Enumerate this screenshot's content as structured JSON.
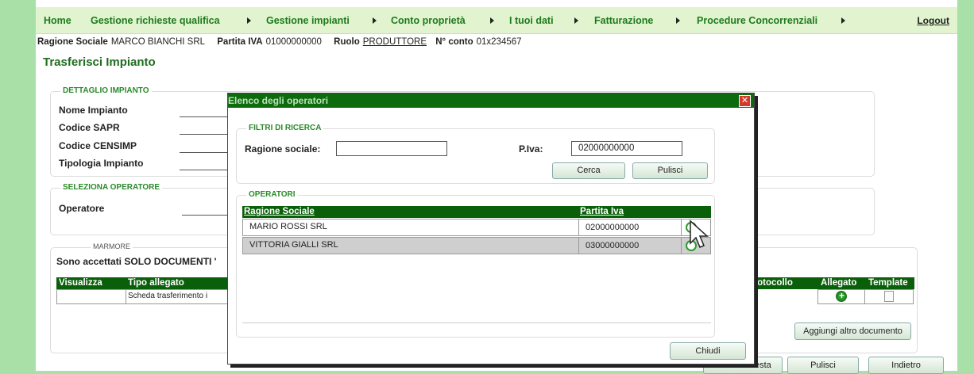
{
  "nav": {
    "items": [
      "Home",
      "Gestione richieste qualifica",
      "Gestione impianti",
      "Conto proprietà",
      "I tuoi dati",
      "Fatturazione",
      "Procedure Concorrenziali"
    ],
    "logout": "Logout"
  },
  "info": {
    "ragione_label": "Ragione Sociale",
    "ragione_value": "MARCO BIANCHI SRL",
    "piva_label": "Partita IVA",
    "piva_value": "01000000000",
    "ruolo_label": "Ruolo",
    "ruolo_value": "PRODUTTORE",
    "conto_label": "N° conto",
    "conto_value": "01x234567"
  },
  "page_title": "Trasferisci Impianto",
  "dettaglio": {
    "legend": "DETTAGLIO IMPIANTO",
    "fields": [
      "Nome Impianto",
      "Codice SAPR",
      "Codice CENSIMP",
      "Tipologia Impianto"
    ]
  },
  "seleziona": {
    "legend": "SELEZIONA OPERATORE",
    "field": "Operatore"
  },
  "marmore": {
    "legend": "MARMORE",
    "note": "Sono accettati SOLO DOCUMENTI '",
    "headers": {
      "visualizza": "Visualizza",
      "tipo": "Tipo allegato",
      "protocollo": "Protocollo",
      "allegato": "Allegato",
      "template": "Template"
    },
    "row_tipo": "Scheda trasferimento i",
    "add_doc_button": "Aggiungi altro documento"
  },
  "bottom_buttons": {
    "invia": "Invia Richiesta",
    "pulisci": "Pulisci",
    "indietro": "Indietro"
  },
  "modal": {
    "title": "Elenco degli operatori",
    "filtri_legend": "FILTRI DI RICERCA",
    "ragione_label": "Ragione sociale:",
    "ragione_value": "",
    "piva_label": "P.Iva:",
    "piva_value": "02000000000",
    "cerca": "Cerca",
    "pulisci": "Pulisci",
    "operatori_legend": "OPERATORI",
    "col_ragione": "Ragione Sociale",
    "col_piva": "Partita Iva",
    "operators": [
      {
        "name": "MARIO ROSSI SRL",
        "piva": "02000000000"
      },
      {
        "name": "VITTORIA GIALLI SRL",
        "piva": "03000000000"
      }
    ],
    "chiudi": "Chiudi"
  },
  "colors": {
    "brand_green": "#0d6a0d",
    "nav_bg": "#e2f4cf",
    "outer_bg": "#a8e0a8"
  }
}
